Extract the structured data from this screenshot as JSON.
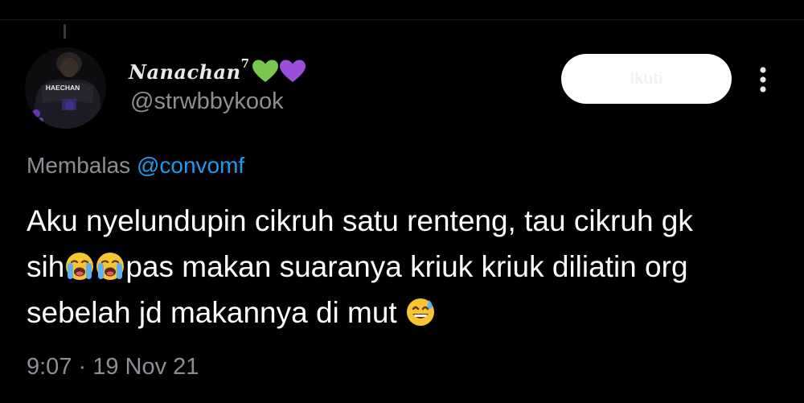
{
  "tweet": {
    "author": {
      "display_name": "Nanachan",
      "display_name_superscript": "7",
      "name_emojis": [
        "green-heart-icon",
        "purple-heart-icon"
      ],
      "handle": "@strwbbykook",
      "avatar_text": "HAECHAN"
    },
    "follow_label": "Ikuti",
    "more_icon": "more-vertical-icon",
    "reply_prefix": "Membalas",
    "reply_to": "@convomf",
    "text": {
      "line1": "Aku nyelundupin cikruh satu renteng, tau cikruh gk",
      "line2_start": "sih",
      "line2_emojis": [
        "loudly-crying-face-icon",
        "loudly-crying-face-icon"
      ],
      "line2_end": "pas makan suaranya kriuk kriuk diliatin org",
      "line3": "sebelah jd makannya di mut ",
      "line3_emoji": "grinning-face-with-sweat-icon"
    },
    "timestamp": "9:07 · 19 Nov 21"
  },
  "colors": {
    "background": "#000000",
    "primary_text": "#ffffff",
    "secondary_text": "#8b9096",
    "link": "#1d9bf0",
    "green_heart": "#78c850",
    "purple_heart": "#9b4fd8",
    "follow_button_bg": "#ffffff"
  }
}
